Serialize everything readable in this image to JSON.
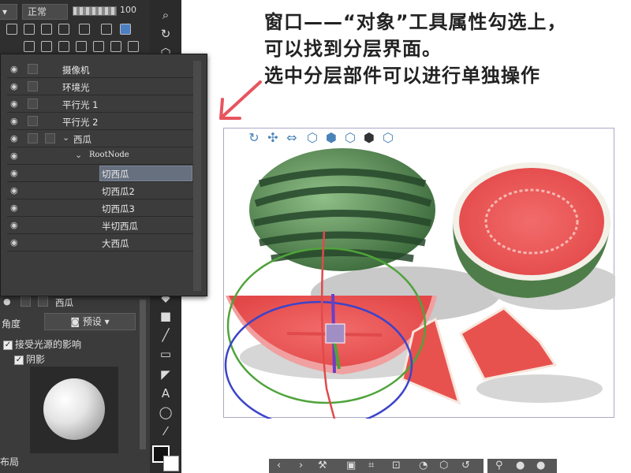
{
  "toolbar": {
    "blend_mode": "正常",
    "opacity": "100"
  },
  "layers": [
    {
      "label": "摄像机"
    },
    {
      "label": "环境光"
    },
    {
      "label": "平行光 1"
    },
    {
      "label": "平行光 2"
    },
    {
      "label": "西瓜"
    },
    {
      "label": "RootNode"
    },
    {
      "label": "切西瓜",
      "selected": true
    },
    {
      "label": "切西瓜2"
    },
    {
      "label": "切西瓜3"
    },
    {
      "label": "半切西瓜"
    },
    {
      "label": "大西瓜"
    }
  ],
  "properties": {
    "layer_name": "西瓜",
    "angle_label": "角度",
    "preset_label": "预设",
    "light_checkbox": "接受光源的影响",
    "shadow_checkbox": "阴影",
    "layout_label": "布局"
  },
  "annotation": {
    "line1": "窗口——“对象”工具属性勾选上，",
    "line2": "可以找到分层界面。",
    "line3": "选中分层部件可以进行单独操作"
  },
  "colors": {
    "arrow": "#e8545e",
    "gizmo_red": "#e04a4a",
    "gizmo_green": "#4fa33a",
    "gizmo_blue": "#3c44c9",
    "selection_box": "#6a7282"
  }
}
